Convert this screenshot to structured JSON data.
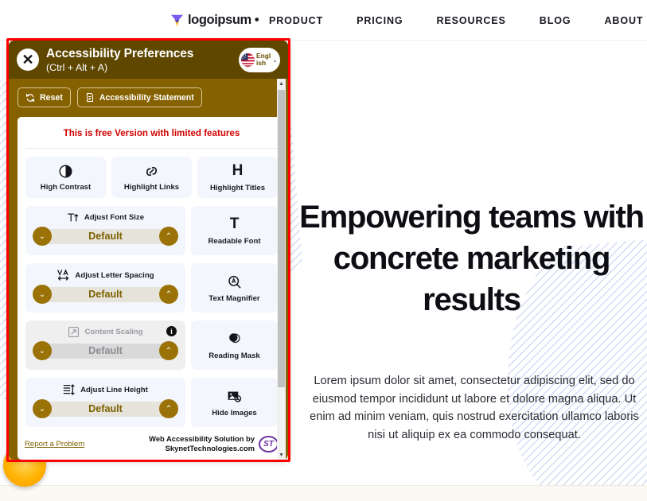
{
  "nav": {
    "logo_text": "logoipsum",
    "logo_dot": "•",
    "links": [
      {
        "label": "PRODUCT"
      },
      {
        "label": "PRICING"
      },
      {
        "label": "RESOURCES"
      },
      {
        "label": "BLOG"
      },
      {
        "label": "ABOUT"
      }
    ]
  },
  "hero": {
    "title": "Empowering teams with concrete marketing results",
    "subtitle": "Lorem ipsum dolor sit amet, consectetur adipiscing elit, sed do eiusmod tempor incididunt ut labore et dolore magna aliqua. Ut enim ad minim veniam, quis nostrud exercitation ullamco laboris nisi ut aliquip ex ea commodo consequat."
  },
  "panel": {
    "title": "Accessibility Preferences",
    "shortcut": "(Ctrl + Alt + A)",
    "close_label": "✕",
    "language": "English",
    "chevron": "⌄",
    "actions": [
      {
        "label": "Reset",
        "icon": "reset-icon"
      },
      {
        "label": "Accessibility Statement",
        "icon": "document-icon"
      }
    ],
    "free_notice": "This is free Version with limited features",
    "toggle_tiles": [
      {
        "label": "High Contrast",
        "icon": "contrast-icon"
      },
      {
        "label": "Highlight Links",
        "icon": "link-icon"
      },
      {
        "label": "Highlight Titles",
        "icon": "heading-icon"
      }
    ],
    "setting_rows": [
      {
        "stepper": {
          "title": "Adjust Font Size",
          "value": "Default",
          "icon": "font-size-icon",
          "disabled": false,
          "info": false
        },
        "tile": {
          "label": "Readable Font",
          "icon": "readable-font-icon"
        }
      },
      {
        "stepper": {
          "title": "Adjust Letter Spacing",
          "value": "Default",
          "icon": "letter-spacing-icon",
          "disabled": false,
          "info": false
        },
        "tile": {
          "label": "Text Magnifier",
          "icon": "text-magnifier-icon"
        }
      },
      {
        "stepper": {
          "title": "Content Scaling",
          "value": "Default",
          "icon": "content-scaling-icon",
          "disabled": true,
          "info": true,
          "info_label": "i"
        },
        "tile": {
          "label": "Reading Mask",
          "icon": "reading-mask-icon"
        }
      },
      {
        "stepper": {
          "title": "Adjust Line Height",
          "value": "Default",
          "icon": "line-height-icon",
          "disabled": false,
          "info": false
        },
        "tile": {
          "label": "Hide Images",
          "icon": "hide-images-icon"
        }
      }
    ],
    "stepper_down": "⌄",
    "stepper_up": "⌃",
    "footer": {
      "report_link": "Report a Problem",
      "brand_line1": "Web Accessibility Solution by",
      "brand_line2": "SkynetTechnologies.com",
      "brand_badge": "ST"
    },
    "scroll_up": "▲",
    "scroll_down": "▼"
  },
  "colors": {
    "panel_header": "#5f4700",
    "panel_body": "#866100",
    "accent_gold": "#9a7207",
    "highlight_red": "#ff0000",
    "notice_red": "#d00000",
    "tile_bg": "#f3f6fc",
    "stripe_blue": "#c7d2f0",
    "brand_purple": "#6b2fa0"
  }
}
